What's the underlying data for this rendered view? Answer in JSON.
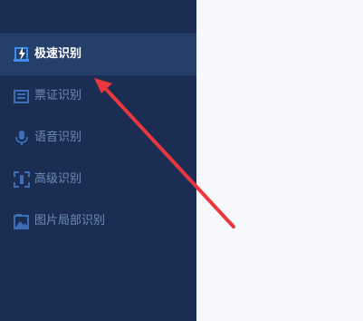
{
  "sidebar": {
    "items": [
      {
        "label": "极速识别",
        "icon": "lightning-document-icon",
        "active": true
      },
      {
        "label": "票证识别",
        "icon": "ticket-icon",
        "active": false
      },
      {
        "label": "语音识别",
        "icon": "microphone-icon",
        "active": false
      },
      {
        "label": "高级识别",
        "icon": "scan-frame-icon",
        "active": false
      },
      {
        "label": "图片局部识别",
        "icon": "image-region-icon",
        "active": false
      }
    ]
  },
  "colors": {
    "sidebar_bg": "#1b2d52",
    "active_bg": "#233f6a",
    "accent": "#3d8ef0",
    "inactive_text": "#6f8bb8",
    "annotation_arrow": "#e8383d"
  }
}
